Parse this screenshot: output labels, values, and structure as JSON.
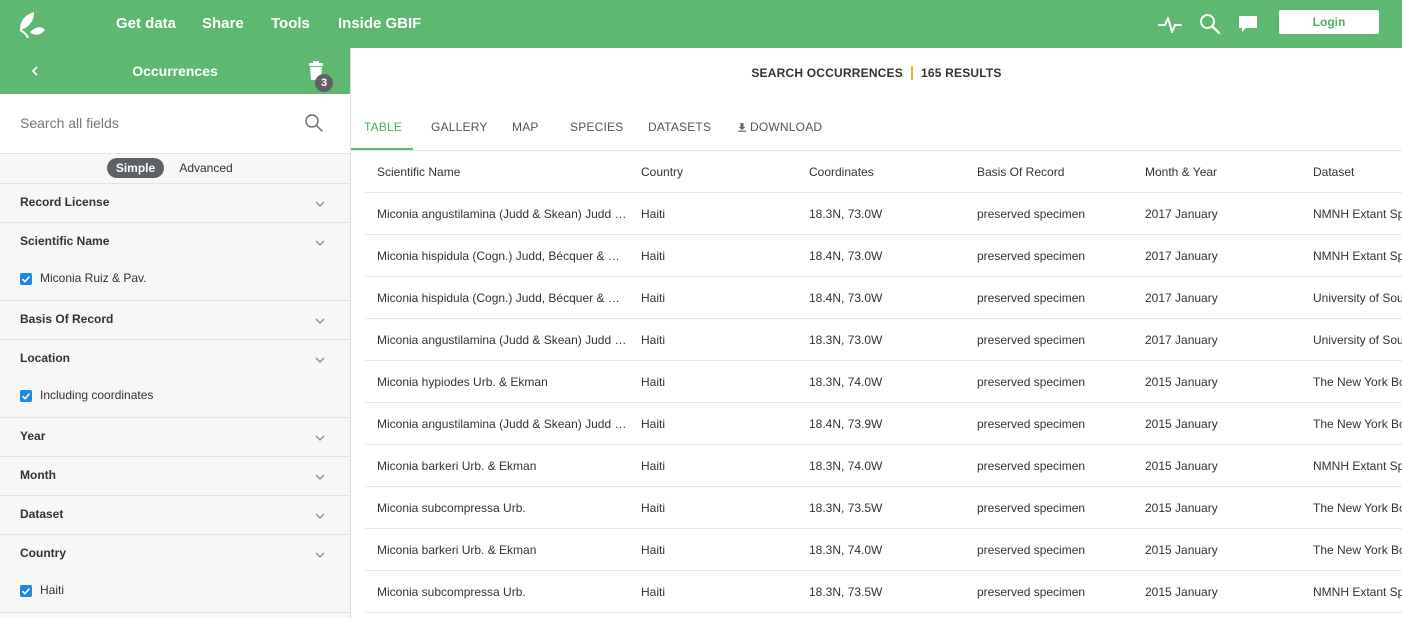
{
  "nav": {
    "links": [
      "Get data",
      "Share",
      "Tools",
      "Inside GBIF"
    ],
    "login_label": "Login"
  },
  "sidebar": {
    "title": "Occurrences",
    "trash_count": "3",
    "search_placeholder": "Search all fields",
    "mode_simple": "Simple",
    "mode_advanced": "Advanced",
    "filters": [
      {
        "label": "Record License",
        "checked": []
      },
      {
        "label": "Scientific Name",
        "checked": [
          "Miconia Ruiz & Pav."
        ]
      },
      {
        "label": "Basis Of Record",
        "checked": []
      },
      {
        "label": "Location",
        "checked": [
          "Including coordinates"
        ]
      },
      {
        "label": "Year",
        "checked": []
      },
      {
        "label": "Month",
        "checked": []
      },
      {
        "label": "Dataset",
        "checked": []
      },
      {
        "label": "Country",
        "checked": [
          "Haiti"
        ]
      }
    ]
  },
  "main": {
    "search_label": "SEARCH OCCURRENCES",
    "results_label": "165 RESULTS",
    "tabs": [
      "TABLE",
      "GALLERY",
      "MAP",
      "SPECIES",
      "DATASETS",
      "DOWNLOAD"
    ],
    "active_tab": "TABLE",
    "columns": [
      "Scientific Name",
      "Country",
      "Coordinates",
      "Basis Of Record",
      "Month & Year",
      "Dataset"
    ],
    "rows": [
      [
        "Miconia angustilamina (Judd & Skean) Judd & Skean",
        "Haiti",
        "18.3N, 73.0W",
        "preserved specimen",
        "2017 January",
        "NMNH Extant Specimen Records"
      ],
      [
        "Miconia hispidula (Cogn.) Judd, Bécquer & Majure",
        "Haiti",
        "18.4N, 73.0W",
        "preserved specimen",
        "2017 January",
        "NMNH Extant Specimen Records"
      ],
      [
        "Miconia hispidula (Cogn.) Judd, Bécquer & Majure",
        "Haiti",
        "18.4N, 73.0W",
        "preserved specimen",
        "2017 January",
        "University of South Florida"
      ],
      [
        "Miconia angustilamina (Judd & Skean) Judd & Skean",
        "Haiti",
        "18.3N, 73.0W",
        "preserved specimen",
        "2017 January",
        "University of South Florida"
      ],
      [
        "Miconia hypiodes Urb. & Ekman",
        "Haiti",
        "18.3N, 74.0W",
        "preserved specimen",
        "2015 January",
        "The New York Botanical Garden"
      ],
      [
        "Miconia angustilamina (Judd & Skean) Judd & Skean",
        "Haiti",
        "18.4N, 73.9W",
        "preserved specimen",
        "2015 January",
        "The New York Botanical Garden"
      ],
      [
        "Miconia barkeri Urb. & Ekman",
        "Haiti",
        "18.3N, 74.0W",
        "preserved specimen",
        "2015 January",
        "NMNH Extant Specimen Records"
      ],
      [
        "Miconia subcompressa Urb.",
        "Haiti",
        "18.3N, 73.5W",
        "preserved specimen",
        "2015 January",
        "The New York Botanical Garden"
      ],
      [
        "Miconia barkeri Urb. & Ekman",
        "Haiti",
        "18.3N, 74.0W",
        "preserved specimen",
        "2015 January",
        "The New York Botanical Garden"
      ],
      [
        "Miconia subcompressa Urb.",
        "Haiti",
        "18.3N, 73.5W",
        "preserved specimen",
        "2015 January",
        "NMNH Extant Specimen Records"
      ]
    ]
  },
  "colors": {
    "brand_green": "#5fb871",
    "accent_orange": "#f0b429",
    "checkbox_blue": "#1e88e5",
    "pill_gray": "#5e6068"
  },
  "icons": [
    "gbif-logo-icon",
    "activity-pulse-icon",
    "search-icon",
    "feedback-chat-icon",
    "chevron-left-icon",
    "trash-icon",
    "chevron-down-icon",
    "download-icon"
  ]
}
